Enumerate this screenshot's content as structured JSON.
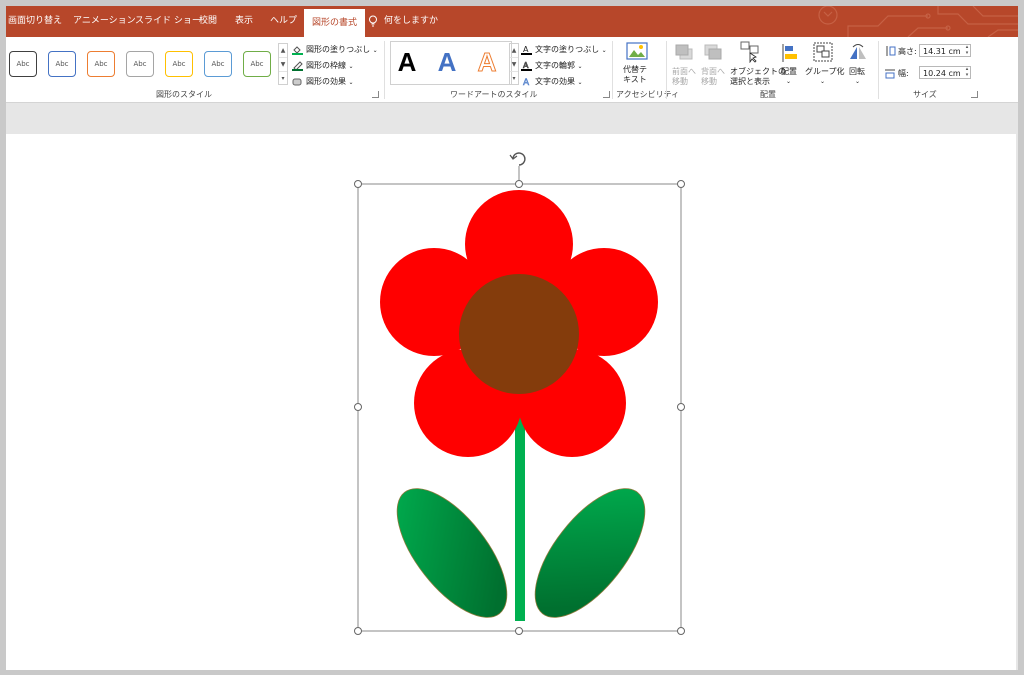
{
  "tabs": {
    "transitions": "画面切り替え",
    "animations": "アニメーション",
    "slideshow": "スライド ショー",
    "review": "校閲",
    "view": "表示",
    "help": "ヘルプ",
    "shape_format": "図形の書式",
    "tell_me": "何をしますか"
  },
  "ribbon": {
    "shape_styles": {
      "swatch_label": "Abc",
      "swatch_colors": [
        "#404040",
        "#4472c4",
        "#ed7d31",
        "#a5a5a5",
        "#ffc000",
        "#5b9bd5",
        "#70ad47"
      ],
      "fill": "図形の塗りつぶし",
      "outline": "図形の枠線",
      "effects": "図形の効果",
      "group_label": "図形のスタイル"
    },
    "wordart": {
      "letter": "A",
      "text_fill": "文字の塗りつぶし",
      "text_outline": "文字の輪郭",
      "text_effects": "文字の効果",
      "group_label": "ワードアートのスタイル"
    },
    "accessibility": {
      "alt_text_line1": "代替テ",
      "alt_text_line2": "キスト",
      "group_label": "アクセシビリティ"
    },
    "arrange": {
      "bring_forward_line1": "前面へ",
      "bring_forward_line2": "移動",
      "send_backward_line1": "背面へ",
      "send_backward_line2": "移動",
      "selection_pane_line1": "オブジェクトの",
      "selection_pane_line2": "選択と表示",
      "align": "配置",
      "group": "グループ化",
      "rotate": "回転",
      "group_label": "配置"
    },
    "size": {
      "height_label": "高さ:",
      "height_value": "14.31 cm",
      "width_label": "幅:",
      "width_value": "10.24 cm",
      "group_label": "サイズ"
    }
  },
  "colors": {
    "accent": "#b7472a",
    "petal": "#ff0000",
    "center": "#843c0c",
    "stem": "#00b050",
    "leaf_light": "#00b050",
    "leaf_dark": "#00702f"
  }
}
